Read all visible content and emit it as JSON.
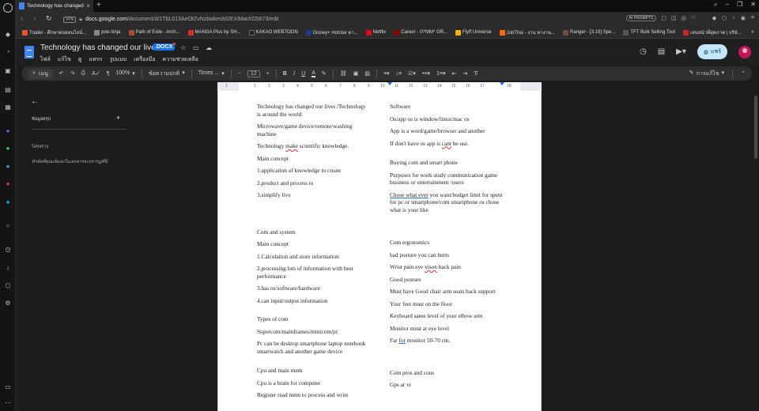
{
  "browser": {
    "tab_title": "Technology has changed o",
    "url_host": "docs.google.com",
    "url_path": "/document/d/1TbL013AeOtZvNzbwkesM2EX9AwXO5673/edit",
    "vpn_label": "VPN",
    "ai_prompts": "AI PROMPTS",
    "bookmarks": [
      {
        "label": "Trader - ศึกษาต่อออนไลน์...",
        "color": "#e4572e"
      },
      {
        "label": "poe.ninja",
        "color": "#888888"
      },
      {
        "label": "Path of Exile - Arch...",
        "color": "#a0522d"
      },
      {
        "label": "MANGA Plus by SH...",
        "color": "#d32f2f"
      },
      {
        "label": "KAKAO WEBTOON",
        "color": "#222222"
      },
      {
        "label": "Disney+ Hotstar ดา...",
        "color": "#1e3a8a"
      },
      {
        "label": "Netflix",
        "color": "#e50914"
      },
      {
        "label": "Career - G*MM* GR...",
        "color": "#8b0000"
      },
      {
        "label": "Flyff Universe",
        "color": "#f4b400"
      },
      {
        "label": "JobThai - งาน หางาน...",
        "color": "#ff6a00"
      },
      {
        "label": "Ranger - [3.19] Spe...",
        "color": "#6d4c41"
      },
      {
        "label": "TFT Bulk Selling Tool",
        "color": "#555555"
      },
      {
        "label": "เล่นหน้าที่สุดภาพ | บริษั...",
        "color": "#c62828"
      }
    ]
  },
  "docs": {
    "title": "Technology has changed our lives",
    "badge": ".DOCX",
    "menu": [
      "ไฟล์",
      "แก้ไข",
      "ดู",
      "แทรก",
      "รูปแบบ",
      "เครื่องมือ",
      "ความช่วยเหลือ"
    ],
    "share_label": "แชร์"
  },
  "toolbar": {
    "search_label": "เมนู",
    "zoom": "100%",
    "style": "ข้อความปกติ",
    "font": "Times ...",
    "font_size": "12",
    "mode": "การแก้ไข"
  },
  "ruler": {
    "labels": [
      "1",
      "1",
      "2",
      "3",
      "4",
      "5",
      "6",
      "7",
      "8",
      "9",
      "10",
      "11",
      "12",
      "13",
      "14",
      "15",
      "16",
      "17",
      "18"
    ]
  },
  "left_panel": {
    "summary": "ข้อมูลสรุป",
    "outline": "โครงร่าง",
    "outline_hint": "หัวข้อที่คุณเพิ่มลงในเอกสารจะปรากฏที่นี่"
  },
  "document": {
    "left": {
      "p1": "Technology has changed our lives /Technology is around the world",
      "p2": "Microwave/game device/remote/washing machine",
      "p3_pre": "Technology ",
      "p3_err": "make",
      "p3_post": " scientific knowledge.",
      "p4": "Main concept",
      "p5": "1.application of knowledge to create",
      "p6": "2.product and process to",
      "p7": "3.simplify live",
      "p8": "Com and system",
      "p9": "Main concept",
      "p10": "1.Calculation and store information",
      "p11": "2.processing lots of information with best performance",
      "p12": "3.has os/software/hardware",
      "p13": "4.can input/output information",
      "p14": "Types of com",
      "p15": "Supercom/mainframes/minicom/pc",
      "p16": "Pc can be desktop smartphone laptop notebook smartwatch and another game device",
      "p17": "Cpu and main mem",
      "p18": "Cpu is a brain for computer",
      "p19": "Register read mem to process and write"
    },
    "right": {
      "p1": "Software",
      "p2": "Os/app os is window/linux/mac os",
      "p3": "App is a word/game/browser and another",
      "p4_pre": "If don't have os app is ",
      "p4_err": "cant",
      "p4_post": " be use.",
      "p5": "Buying com and smart phone",
      "p6": "Purposes for work study communication game business or entertainment /users",
      "p7_err": "Chose what ever",
      "p7_post": " you want/budget limit for spent for pc or smartphone/com smartphone os chose what is your like",
      "p8": "Com ergonomics",
      "p9": "bad posture you can hurts",
      "p10_pre": "Wrist pain eye ",
      "p10_err": "vison",
      "p10_post": " back pain",
      "p11": "Good posture",
      "p12": "Must have Good chair arm seats back support",
      "p13": "Your feet must on the floor",
      "p14": "Keyboard same level of your elbow arm",
      "p15": "Monitor must at eye level",
      "p16_pre": "Far ",
      "p16_err": "for",
      "p16_post": " monitor 50-70 cm.",
      "p17": "Com pros and cons",
      "p18": "Gps ar vr"
    }
  }
}
